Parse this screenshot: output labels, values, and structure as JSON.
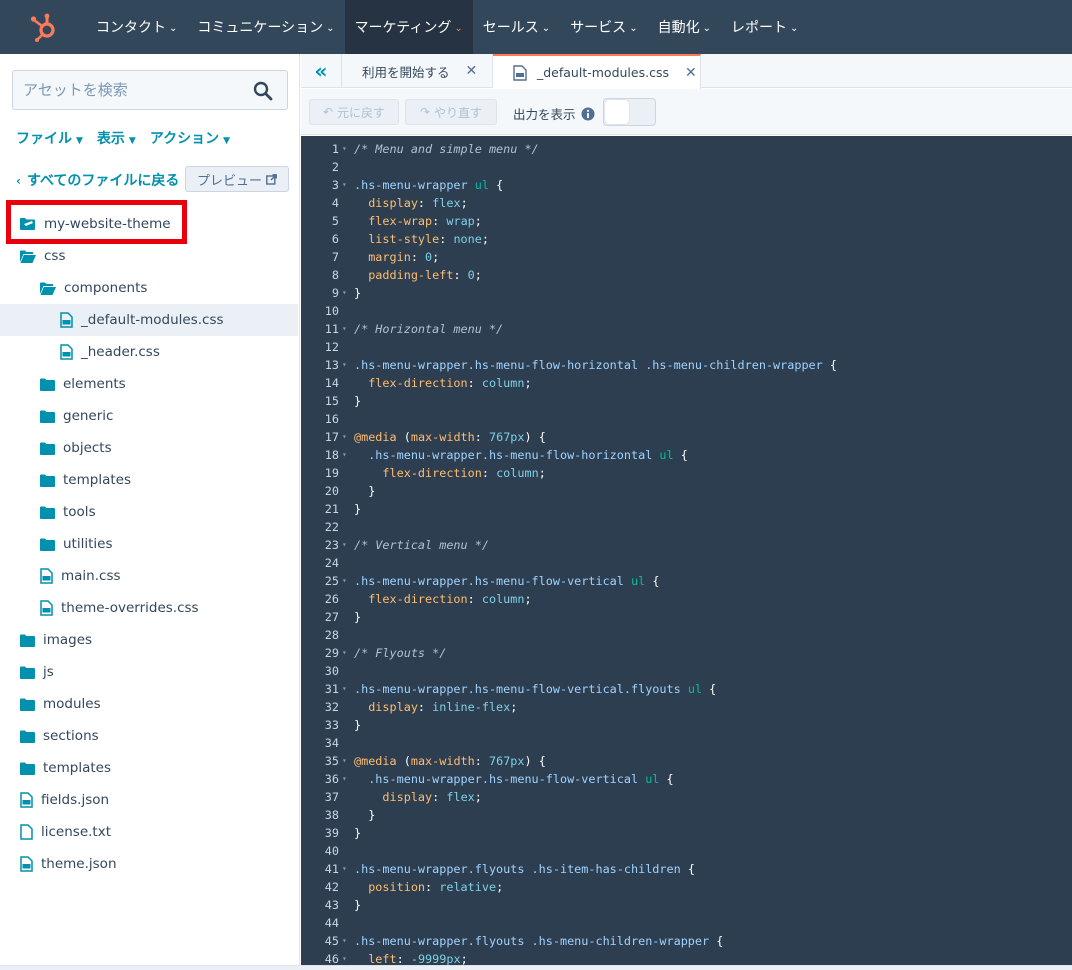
{
  "topnav": {
    "items": [
      {
        "label": "コンタクト",
        "active": false
      },
      {
        "label": "コミュニケーション",
        "active": false
      },
      {
        "label": "マーケティング",
        "active": true
      },
      {
        "label": "セールス",
        "active": false
      },
      {
        "label": "サービス",
        "active": false
      },
      {
        "label": "自動化",
        "active": false
      },
      {
        "label": "レポート",
        "active": false
      }
    ],
    "brand_color": "#ff7a59",
    "bg_color": "#33475b"
  },
  "sidebar": {
    "search_placeholder": "アセットを検索",
    "menus": [
      "ファイル",
      "表示",
      "アクション"
    ],
    "back_label": "すべてのファイルに戻る",
    "preview_label": "プレビュー",
    "tree": [
      {
        "label": "my-website-theme",
        "icon": "theme-folder-icon",
        "indent": 0
      },
      {
        "label": "css",
        "icon": "folder-open-icon",
        "indent": 0
      },
      {
        "label": "components",
        "icon": "folder-open-icon",
        "indent": 1
      },
      {
        "label": "_default-modules.css",
        "icon": "css-file-icon",
        "indent": 2,
        "selected": true
      },
      {
        "label": "_header.css",
        "icon": "css-file-icon",
        "indent": 2
      },
      {
        "label": "elements",
        "icon": "folder-icon",
        "indent": 1
      },
      {
        "label": "generic",
        "icon": "folder-icon",
        "indent": 1
      },
      {
        "label": "objects",
        "icon": "folder-icon",
        "indent": 1
      },
      {
        "label": "templates",
        "icon": "folder-icon",
        "indent": 1
      },
      {
        "label": "tools",
        "icon": "folder-icon",
        "indent": 1
      },
      {
        "label": "utilities",
        "icon": "folder-icon",
        "indent": 1
      },
      {
        "label": "main.css",
        "icon": "css-file-icon",
        "indent": 1
      },
      {
        "label": "theme-overrides.css",
        "icon": "css-file-icon",
        "indent": 1
      },
      {
        "label": "images",
        "icon": "folder-icon",
        "indent": 0
      },
      {
        "label": "js",
        "icon": "folder-icon",
        "indent": 0
      },
      {
        "label": "modules",
        "icon": "folder-icon",
        "indent": 0
      },
      {
        "label": "sections",
        "icon": "folder-icon",
        "indent": 0
      },
      {
        "label": "templates",
        "icon": "folder-icon",
        "indent": 0
      },
      {
        "label": "fields.json",
        "icon": "json-file-icon",
        "indent": 0
      },
      {
        "label": "license.txt",
        "icon": "text-file-icon",
        "indent": 0
      },
      {
        "label": "theme.json",
        "icon": "json-file-icon",
        "indent": 0
      }
    ],
    "highlight_color": "#e8000b"
  },
  "editor": {
    "tabs": [
      {
        "label": "利用を開始する",
        "active": false
      },
      {
        "label": "_default-modules.css",
        "active": true
      }
    ],
    "undo_label": "元に戻す",
    "redo_label": "やり直す",
    "output_label": "出力を表示",
    "output_toggle": false,
    "code_lines": [
      [
        [
          "/* Menu and simple menu */",
          "comment"
        ]
      ],
      [],
      [
        [
          ".hs-menu-wrapper ",
          "sel"
        ],
        [
          "ul",
          "tag"
        ],
        [
          " {",
          "punc"
        ]
      ],
      [
        [
          "  display",
          "prop"
        ],
        [
          ": ",
          "punc"
        ],
        [
          "flex",
          "val"
        ],
        [
          ";",
          "punc"
        ]
      ],
      [
        [
          "  flex-wrap",
          "prop"
        ],
        [
          ": ",
          "punc"
        ],
        [
          "wrap",
          "val"
        ],
        [
          ";",
          "punc"
        ]
      ],
      [
        [
          "  list-style",
          "prop"
        ],
        [
          ": ",
          "punc"
        ],
        [
          "none",
          "val"
        ],
        [
          ";",
          "punc"
        ]
      ],
      [
        [
          "  margin",
          "prop"
        ],
        [
          ": ",
          "punc"
        ],
        [
          "0",
          "num"
        ],
        [
          ";",
          "punc"
        ]
      ],
      [
        [
          "  padding-left",
          "prop"
        ],
        [
          ": ",
          "punc"
        ],
        [
          "0",
          "num"
        ],
        [
          ";",
          "punc"
        ]
      ],
      [
        [
          "}",
          "punc"
        ]
      ],
      [],
      [
        [
          "/* Horizontal menu */",
          "comment"
        ]
      ],
      [],
      [
        [
          ".hs-menu-wrapper.hs-menu-flow-horizontal .hs-menu-children-wrapper",
          "sel"
        ],
        [
          " {",
          "punc"
        ]
      ],
      [
        [
          "  flex-direction",
          "prop"
        ],
        [
          ": ",
          "punc"
        ],
        [
          "column",
          "val"
        ],
        [
          ";",
          "punc"
        ]
      ],
      [
        [
          "}",
          "punc"
        ]
      ],
      [],
      [
        [
          "@media",
          "at"
        ],
        [
          " (",
          "punc"
        ],
        [
          "max-width",
          "prop"
        ],
        [
          ": ",
          "punc"
        ],
        [
          "767px",
          "num"
        ],
        [
          ") {",
          "punc"
        ]
      ],
      [
        [
          "  .hs-menu-wrapper.hs-menu-flow-horizontal ",
          "sel"
        ],
        [
          "ul",
          "tag"
        ],
        [
          " {",
          "punc"
        ]
      ],
      [
        [
          "    flex-direction",
          "prop"
        ],
        [
          ": ",
          "punc"
        ],
        [
          "column",
          "val"
        ],
        [
          ";",
          "punc"
        ]
      ],
      [
        [
          "  }",
          "punc"
        ]
      ],
      [
        [
          "}",
          "punc"
        ]
      ],
      [],
      [
        [
          "/* Vertical menu */",
          "comment"
        ]
      ],
      [],
      [
        [
          ".hs-menu-wrapper.hs-menu-flow-vertical ",
          "sel"
        ],
        [
          "ul",
          "tag"
        ],
        [
          " {",
          "punc"
        ]
      ],
      [
        [
          "  flex-direction",
          "prop"
        ],
        [
          ": ",
          "punc"
        ],
        [
          "column",
          "val"
        ],
        [
          ";",
          "punc"
        ]
      ],
      [
        [
          "}",
          "punc"
        ]
      ],
      [],
      [
        [
          "/* Flyouts */",
          "comment"
        ]
      ],
      [],
      [
        [
          ".hs-menu-wrapper.hs-menu-flow-vertical.flyouts ",
          "sel"
        ],
        [
          "ul",
          "tag"
        ],
        [
          " {",
          "punc"
        ]
      ],
      [
        [
          "  display",
          "prop"
        ],
        [
          ": ",
          "punc"
        ],
        [
          "inline-flex",
          "val"
        ],
        [
          ";",
          "punc"
        ]
      ],
      [
        [
          "}",
          "punc"
        ]
      ],
      [],
      [
        [
          "@media",
          "at"
        ],
        [
          " (",
          "punc"
        ],
        [
          "max-width",
          "prop"
        ],
        [
          ": ",
          "punc"
        ],
        [
          "767px",
          "num"
        ],
        [
          ") {",
          "punc"
        ]
      ],
      [
        [
          "  .hs-menu-wrapper.hs-menu-flow-vertical ",
          "sel"
        ],
        [
          "ul",
          "tag"
        ],
        [
          " {",
          "punc"
        ]
      ],
      [
        [
          "    display",
          "prop"
        ],
        [
          ": ",
          "punc"
        ],
        [
          "flex",
          "val"
        ],
        [
          ";",
          "punc"
        ]
      ],
      [
        [
          "  }",
          "punc"
        ]
      ],
      [
        [
          "}",
          "punc"
        ]
      ],
      [],
      [
        [
          ".hs-menu-wrapper.flyouts .hs-item-has-children",
          "sel"
        ],
        [
          " {",
          "punc"
        ]
      ],
      [
        [
          "  position",
          "prop"
        ],
        [
          ": ",
          "punc"
        ],
        [
          "relative",
          "val"
        ],
        [
          ";",
          "punc"
        ]
      ],
      [
        [
          "}",
          "punc"
        ]
      ],
      [],
      [
        [
          ".hs-menu-wrapper.flyouts .hs-menu-children-wrapper",
          "sel"
        ],
        [
          " {",
          "punc"
        ]
      ],
      [
        [
          "  left",
          "prop"
        ],
        [
          ": ",
          "punc"
        ],
        [
          "-9999px",
          "num"
        ],
        [
          ";",
          "punc"
        ]
      ]
    ],
    "fold_lines": [
      1,
      3,
      9,
      11,
      13,
      17,
      18,
      23,
      25,
      29,
      31,
      35,
      36,
      41,
      45,
      46
    ],
    "code_bg": "#2d3e50"
  }
}
